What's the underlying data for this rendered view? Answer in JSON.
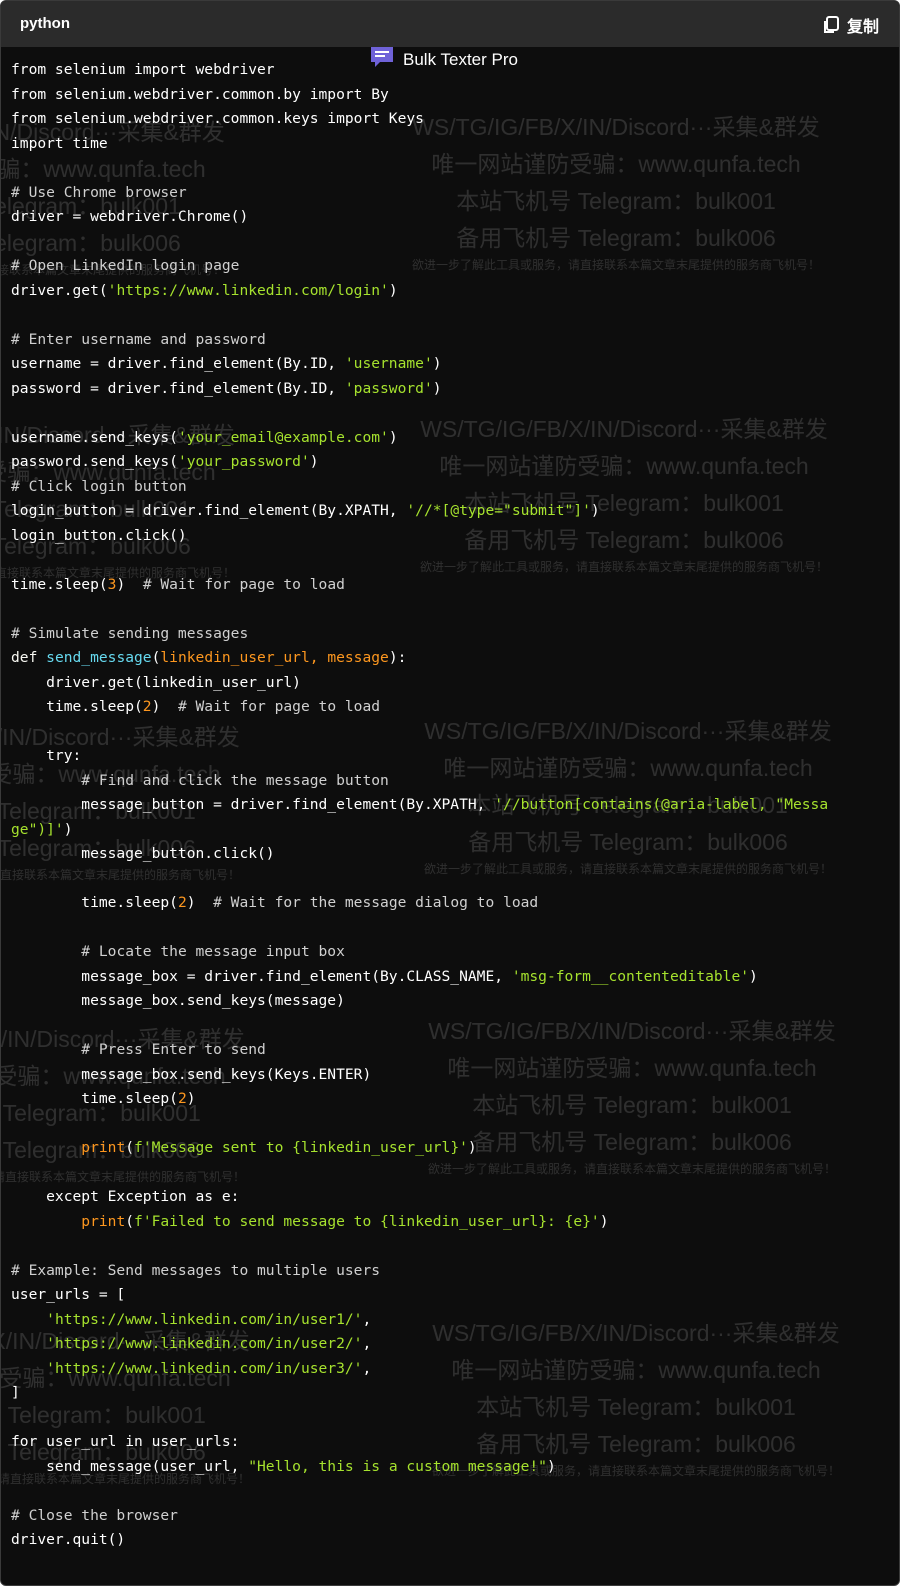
{
  "header": {
    "language": "python",
    "copy_label": "复制"
  },
  "brand": {
    "name": "Bulk Texter Pro"
  },
  "watermark": {
    "line1": "WS/TG/IG/FB/X/IN/Discord···采集&群发",
    "line2": "唯一网站谨防受骗：www.qunfa.tech",
    "line3": "本站飞机号 Telegram：bulk001",
    "line4": "备用飞机号 Telegram：bulk006",
    "line5": "欲进一步了解此工具或服务，请直接联系本篇文章末尾提供的服务商飞机号！"
  },
  "code_lines": [
    [
      {
        "t": "from selenium import webdriver"
      }
    ],
    [
      {
        "t": "from selenium.webdriver.common.by import By"
      }
    ],
    [
      {
        "t": "from selenium.webdriver.common.keys import Keys"
      }
    ],
    [
      {
        "t": "import time"
      }
    ],
    [
      {
        "t": ""
      }
    ],
    [
      {
        "t": "# Use Chrome browser",
        "c": "cm"
      }
    ],
    [
      {
        "t": "driver = webdriver.Chrome()"
      }
    ],
    [
      {
        "t": ""
      }
    ],
    [
      {
        "t": "# Open LinkedIn login page",
        "c": "cm"
      }
    ],
    [
      {
        "t": "driver.get("
      },
      {
        "t": "'https://www.linkedin.com/login'",
        "c": "st"
      },
      {
        "t": ")"
      }
    ],
    [
      {
        "t": ""
      }
    ],
    [
      {
        "t": "# Enter username and password",
        "c": "cm"
      }
    ],
    [
      {
        "t": "username = driver.find_element(By.ID, "
      },
      {
        "t": "'username'",
        "c": "st"
      },
      {
        "t": ")"
      }
    ],
    [
      {
        "t": "password = driver.find_element(By.ID, "
      },
      {
        "t": "'password'",
        "c": "st"
      },
      {
        "t": ")"
      }
    ],
    [
      {
        "t": ""
      }
    ],
    [
      {
        "t": "username.send_keys("
      },
      {
        "t": "'your_email@example.com'",
        "c": "st"
      },
      {
        "t": ")"
      }
    ],
    [
      {
        "t": "password.send_keys("
      },
      {
        "t": "'your_password'",
        "c": "st"
      },
      {
        "t": ")"
      }
    ],
    [
      {
        "t": "# Click login button",
        "c": "cm"
      }
    ],
    [
      {
        "t": "login_button = driver.find_element(By.XPATH, "
      },
      {
        "t": "'//*[@type=\"submit\"]'",
        "c": "st"
      },
      {
        "t": ")"
      }
    ],
    [
      {
        "t": "login_button.click()"
      }
    ],
    [
      {
        "t": ""
      }
    ],
    [
      {
        "t": "time.sleep("
      },
      {
        "t": "3",
        "c": "nu"
      },
      {
        "t": ")  "
      },
      {
        "t": "# Wait for page to load",
        "c": "cm"
      }
    ],
    [
      {
        "t": ""
      }
    ],
    [
      {
        "t": "# Simulate sending messages",
        "c": "cm"
      }
    ],
    [
      {
        "t": "def ",
        "c": "kw"
      },
      {
        "t": "send_message",
        "c": "fn"
      },
      {
        "t": "("
      },
      {
        "t": "linkedin_user_url, message",
        "c": "pa"
      },
      {
        "t": "):"
      }
    ],
    [
      {
        "t": "    driver.get(linkedin_user_url)"
      }
    ],
    [
      {
        "t": "    time.sleep("
      },
      {
        "t": "2",
        "c": "nu"
      },
      {
        "t": ")  "
      },
      {
        "t": "# Wait for page to load",
        "c": "cm"
      }
    ],
    [
      {
        "t": ""
      }
    ],
    [
      {
        "t": "    try:"
      }
    ],
    [
      {
        "t": "        "
      },
      {
        "t": "# Find and click the message button",
        "c": "cm"
      }
    ],
    [
      {
        "t": "        message_button = driver.find_element(By.XPATH, "
      },
      {
        "t": "'//button[contains(@aria-label, \"Messa",
        "c": "st"
      }
    ],
    [
      {
        "t": "ge\")]'",
        "c": "st"
      },
      {
        "t": ")"
      }
    ],
    [
      {
        "t": "        message_button.click()"
      }
    ],
    [
      {
        "t": ""
      }
    ],
    [
      {
        "t": "        time.sleep("
      },
      {
        "t": "2",
        "c": "nu"
      },
      {
        "t": ")  "
      },
      {
        "t": "# Wait for the message dialog to load",
        "c": "cm"
      }
    ],
    [
      {
        "t": ""
      }
    ],
    [
      {
        "t": "        "
      },
      {
        "t": "# Locate the message input box",
        "c": "cm"
      }
    ],
    [
      {
        "t": "        message_box = driver.find_element(By.CLASS_NAME, "
      },
      {
        "t": "'msg-form__contenteditable'",
        "c": "st"
      },
      {
        "t": ")"
      }
    ],
    [
      {
        "t": "        message_box.send_keys(message)"
      }
    ],
    [
      {
        "t": ""
      }
    ],
    [
      {
        "t": "        "
      },
      {
        "t": "# Press Enter to send",
        "c": "cm"
      }
    ],
    [
      {
        "t": "        message_box.send_keys(Keys.ENTER)"
      }
    ],
    [
      {
        "t": "        time.sleep("
      },
      {
        "t": "2",
        "c": "nu"
      },
      {
        "t": ")"
      }
    ],
    [
      {
        "t": ""
      }
    ],
    [
      {
        "t": "        "
      },
      {
        "t": "print",
        "c": "bi"
      },
      {
        "t": "("
      },
      {
        "t": "f'Message sent to {linkedin_user_url}'",
        "c": "st"
      },
      {
        "t": ")"
      }
    ],
    [
      {
        "t": ""
      }
    ],
    [
      {
        "t": "    except Exception as e:"
      }
    ],
    [
      {
        "t": "        "
      },
      {
        "t": "print",
        "c": "bi"
      },
      {
        "t": "("
      },
      {
        "t": "f'Failed to send message to {linkedin_user_url}: {e}'",
        "c": "st"
      },
      {
        "t": ")"
      }
    ],
    [
      {
        "t": ""
      }
    ],
    [
      {
        "t": "# Example: Send messages to multiple users",
        "c": "cm"
      }
    ],
    [
      {
        "t": "user_urls = ["
      }
    ],
    [
      {
        "t": "    "
      },
      {
        "t": "'https://www.linkedin.com/in/user1/'",
        "c": "st"
      },
      {
        "t": ","
      }
    ],
    [
      {
        "t": "    "
      },
      {
        "t": "'https://www.linkedin.com/in/user2/'",
        "c": "st"
      },
      {
        "t": ","
      }
    ],
    [
      {
        "t": "    "
      },
      {
        "t": "'https://www.linkedin.com/in/user3/'",
        "c": "st"
      },
      {
        "t": ","
      }
    ],
    [
      {
        "t": "]"
      }
    ],
    [
      {
        "t": ""
      }
    ],
    [
      {
        "t": "for user_url in user_urls:"
      }
    ],
    [
      {
        "t": "    send_message(user_url, "
      },
      {
        "t": "\"Hello, this is a custom message!\"",
        "c": "st"
      },
      {
        "t": ")"
      }
    ],
    [
      {
        "t": ""
      }
    ],
    [
      {
        "t": "# Close the browser",
        "c": "cm"
      }
    ],
    [
      {
        "t": "driver.quit()"
      }
    ]
  ]
}
